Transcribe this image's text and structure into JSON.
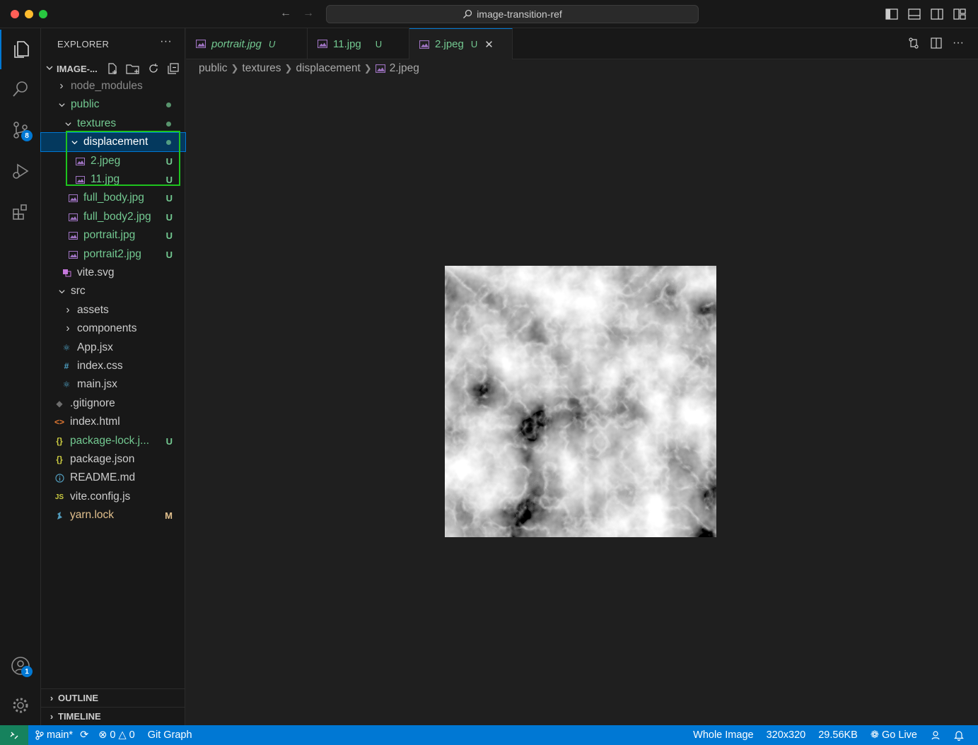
{
  "titlebar": {
    "search_text": "image-transition-ref"
  },
  "activity_bar": {
    "source_control_badge": "8",
    "accounts_badge": "1"
  },
  "explorer": {
    "header": "EXPLORER",
    "more": "···",
    "root_label": "IMAGE-...",
    "items": [
      {
        "label": "node_modules",
        "badge": ""
      },
      {
        "label": "public",
        "badge": ""
      },
      {
        "label": "textures",
        "badge": ""
      },
      {
        "label": "displacement",
        "badge": ""
      },
      {
        "label": "2.jpeg",
        "badge": "U"
      },
      {
        "label": "11.jpg",
        "badge": "U"
      },
      {
        "label": "full_body.jpg",
        "badge": "U"
      },
      {
        "label": "full_body2.jpg",
        "badge": "U"
      },
      {
        "label": "portrait.jpg",
        "badge": "U"
      },
      {
        "label": "portrait2.jpg",
        "badge": "U"
      },
      {
        "label": "vite.svg",
        "badge": ""
      },
      {
        "label": "src",
        "badge": ""
      },
      {
        "label": "assets",
        "badge": ""
      },
      {
        "label": "components",
        "badge": ""
      },
      {
        "label": "App.jsx",
        "badge": ""
      },
      {
        "label": "index.css",
        "badge": ""
      },
      {
        "label": "main.jsx",
        "badge": ""
      },
      {
        "label": ".gitignore",
        "badge": ""
      },
      {
        "label": "index.html",
        "badge": ""
      },
      {
        "label": "package-lock.j...",
        "badge": "U"
      },
      {
        "label": "package.json",
        "badge": ""
      },
      {
        "label": "README.md",
        "badge": ""
      },
      {
        "label": "vite.config.js",
        "badge": ""
      },
      {
        "label": "yarn.lock",
        "badge": "M"
      }
    ],
    "outline_label": "OUTLINE",
    "timeline_label": "TIMELINE"
  },
  "tabs": [
    {
      "label": "portrait.jpg",
      "status": "U"
    },
    {
      "label": "11.jpg",
      "status": "U"
    },
    {
      "label": "2.jpeg",
      "status": "U"
    }
  ],
  "breadcrumb": [
    "public",
    "textures",
    "displacement",
    "2.jpeg"
  ],
  "statusbar": {
    "branch": "main*",
    "errors": "0",
    "warnings": "0",
    "git_graph": "Git Graph",
    "whole_image": "Whole Image",
    "dimensions": "320x320",
    "size": "29.56KB",
    "go_live": "Go Live"
  },
  "colors": {
    "accent": "#0078d4",
    "untracked": "#73c991",
    "modified": "#e2c08d",
    "highlight_box": "#1ec31e",
    "remote": "#16825d"
  }
}
